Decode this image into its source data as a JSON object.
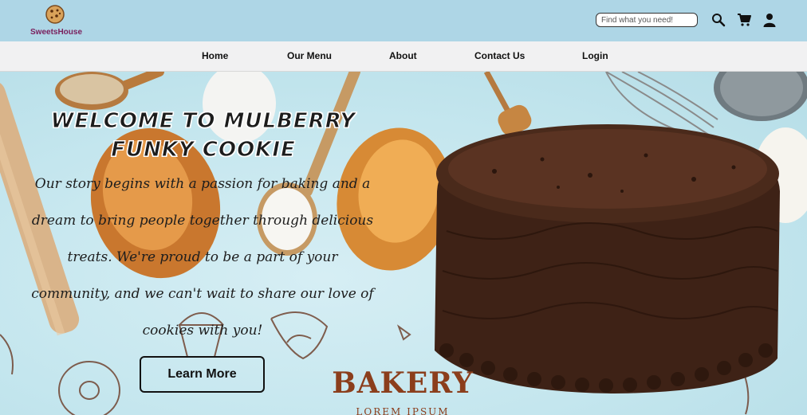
{
  "brand": {
    "name": "SweetsHouse"
  },
  "search": {
    "placeholder": "Find what you need!"
  },
  "header_icons": [
    "search-icon",
    "cart-icon",
    "user-icon"
  ],
  "nav": {
    "items": [
      {
        "label": "Home"
      },
      {
        "label": "Our Menu"
      },
      {
        "label": "About"
      },
      {
        "label": "Contact Us"
      },
      {
        "label": "Login"
      }
    ]
  },
  "hero": {
    "title_line1": "WELCOME TO MULBERRY",
    "title_line2": "FUNKY COOKIE",
    "text": "Our story begins with a passion for baking and a dream to bring people together through delicious treats. We're proud to be a part of your community, and we can't wait to share our love of cookies with you!",
    "button_label": "Learn More",
    "banner_title": "BAKERY",
    "banner_sub": "LOREM IPSUM"
  },
  "colors": {
    "header_bg": "#aed6e6",
    "nav_bg": "#f1f1f2",
    "hero_bg": "#c4e6ee",
    "bakery_brown": "#8b3e1c",
    "chocolate": "#3e2216"
  }
}
